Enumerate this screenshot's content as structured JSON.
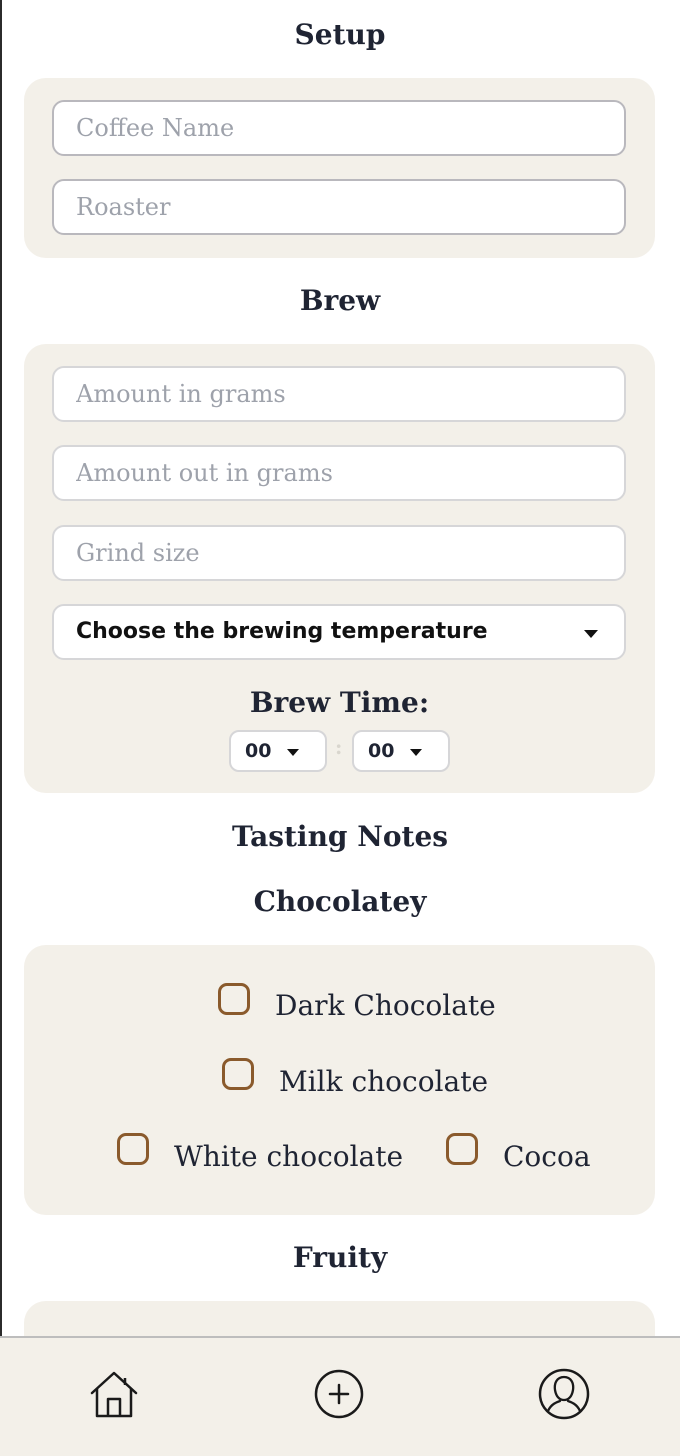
{
  "setup": {
    "title": "Setup",
    "coffee_name_placeholder": "Coffee Name",
    "roaster_placeholder": "Roaster"
  },
  "brew": {
    "title": "Brew",
    "amount_in_placeholder": "Amount in grams",
    "amount_out_placeholder": "Amount out in grams",
    "grind_size_placeholder": "Grind size",
    "temperature_select": "Choose the brewing temperature",
    "brew_time_label": "Brew Time:",
    "minutes": "00",
    "seconds": "00",
    "separator": ":"
  },
  "tasting_notes": {
    "title": "Tasting Notes",
    "chocolatey": {
      "title": "Chocolatey",
      "options": [
        "Dark Chocolate",
        "Milk chocolate",
        "White chocolate",
        "Cocoa"
      ]
    },
    "fruity": {
      "title": "Fruity"
    }
  },
  "nav": {
    "items": [
      "home-icon",
      "add-icon",
      "profile-icon"
    ]
  },
  "colors": {
    "card_bg": "#f3f0e9",
    "checkbox_border": "#8a5a2c",
    "text": "#1f2433"
  }
}
